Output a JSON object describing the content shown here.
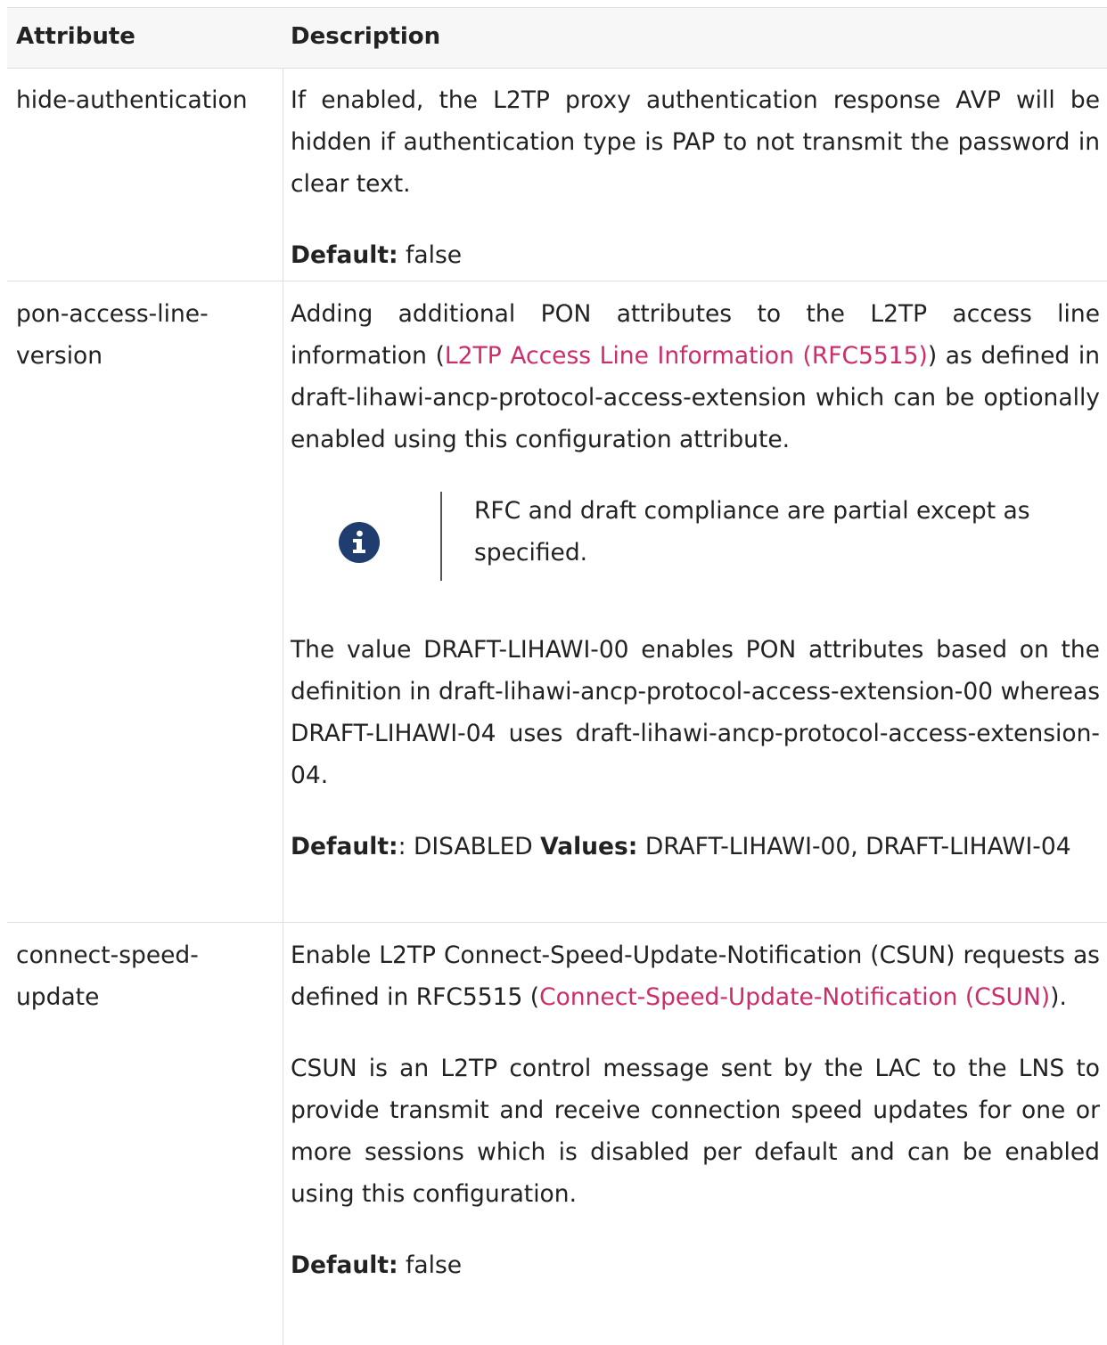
{
  "table": {
    "headers": {
      "attribute": "Attribute",
      "description": "Description"
    },
    "rows": [
      {
        "attribute": "hide-authentication",
        "description": "If enabled, the L2TP proxy authentication response AVP will be hidden if authentication type is PAP to not transmit the password in clear text.",
        "default_label": "Default:",
        "default_value": " false"
      },
      {
        "attribute": "pon-access-line-version",
        "desc_before_link": "Adding additional PON attributes to the L2TP access line information (",
        "link": "L2TP Access Line Information (RFC5515)",
        "desc_after_link": ") as defined in draft-lihawi-ancp-protocol-access-extension which can be optionally enabled using this configuration attribute.",
        "note_icon": "info-icon",
        "note_text": "RFC and draft compliance are partial except as specified.",
        "paragraph2": "The value DRAFT-LIHAWI-00 enables PON attributes based on the definition in draft-lihawi-ancp-protocol-access-extension-00 whereas DRAFT-LIHAWI-04 uses draft-lihawi-ancp-protocol-access-extension-04.",
        "default_label": "Default:",
        "default_value": ": DISABLED ",
        "values_label": "Values:",
        "values_value": " DRAFT-LIHAWI-00, DRAFT-LIHAWI-04"
      },
      {
        "attribute": "connect-speed-update",
        "desc_before_link": "Enable L2TP Connect-Speed-Update-Notification (CSUN) requests as defined in RFC5515 (",
        "link": "Connect-Speed-Update-Notification (CSUN)",
        "desc_after_link": ").",
        "paragraph2": "CSUN is an L2TP control message sent by the LAC to the LNS to provide transmit and receive connection speed updates for one or more sessions which is disabled per default and can be enabled using this configuration.",
        "default_label": "Default:",
        "default_value": " false"
      }
    ]
  },
  "colors": {
    "link": "#cc2d6b",
    "info_icon_bg": "#1f3d6e",
    "border": "#dedede",
    "header_bg": "#f7f7f8"
  }
}
